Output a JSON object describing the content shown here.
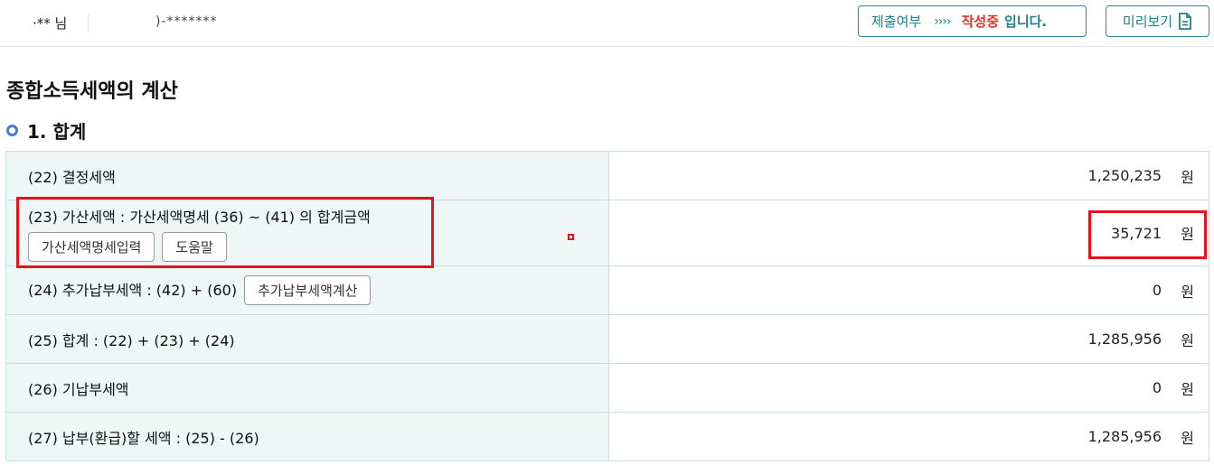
{
  "header": {
    "user_name": "·** 님",
    "user_id": ")-*******",
    "status_label": "제출여부",
    "status_arrows": "››››",
    "status_value": "작성중",
    "status_suffix": "입니다.",
    "preview_label": "미리보기"
  },
  "page_title": "종합소득세액의 계산",
  "section_title": "1. 합계",
  "rows": [
    {
      "label": "(22) 결정세액",
      "value": "1,250,235",
      "unit": "원"
    },
    {
      "label": "(23) 가산세액 : 가산세액명세 (36) ~ (41) 의 합계금액",
      "value": "35,721",
      "unit": "원",
      "buttons": [
        "가산세액명세입력",
        "도움말"
      ]
    },
    {
      "label": "(24) 추가납부세액 : (42) + (60)",
      "value": "0",
      "unit": "원",
      "button": "추가납부세액계산"
    },
    {
      "label": "(25) 합계 : (22) + (23) + (24)",
      "value": "1,285,956",
      "unit": "원"
    },
    {
      "label": "(26) 기납부세액",
      "value": "0",
      "unit": "원"
    },
    {
      "label": "(27) 납부(환급)할 세액 : (25) - (26)",
      "value": "1,285,956",
      "unit": "원"
    }
  ],
  "colors": {
    "accent": "#2b8a97",
    "status_red": "#e0352b",
    "highlight": "#e3141f",
    "label_bg": "#eef6f6"
  }
}
